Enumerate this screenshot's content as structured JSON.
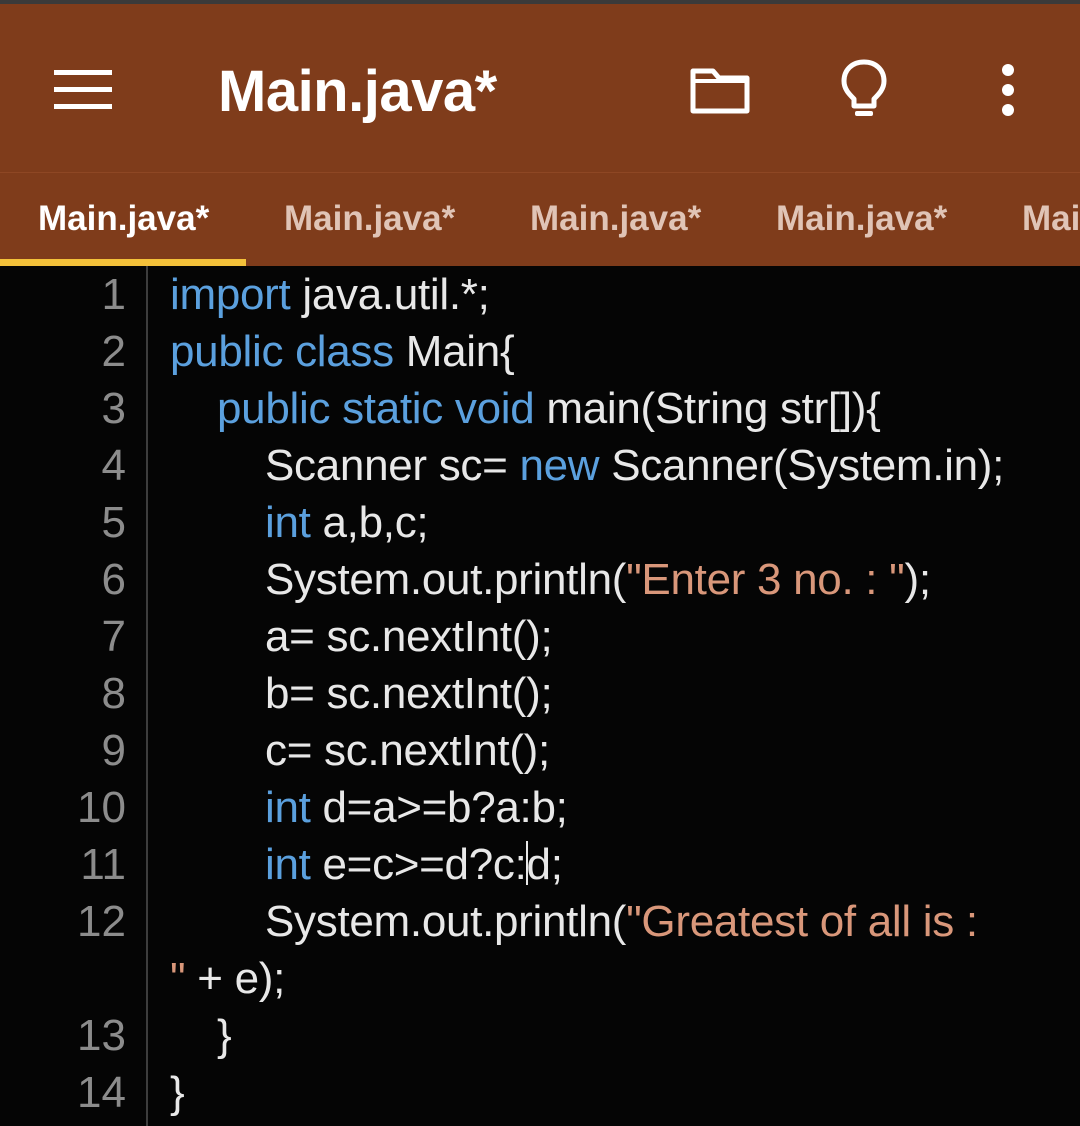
{
  "toolbar": {
    "menu_icon": "hamburger-menu-icon",
    "title": "Main.java*",
    "folder_icon": "folder-icon",
    "bulb_icon": "lightbulb-icon",
    "more_icon": "more-vert-icon",
    "background_color": "#7f3c1b"
  },
  "tabs": [
    {
      "label": "Main.java*",
      "active": true
    },
    {
      "label": "Main.java*",
      "active": false
    },
    {
      "label": "Main.java*",
      "active": false
    },
    {
      "label": "Main.java*",
      "active": false
    },
    {
      "label": "Mai",
      "active": false
    }
  ],
  "editor": {
    "active_tab_indicator_color": "#f4c13a",
    "keyword_color": "#5ba0de",
    "string_color": "#d9977a",
    "line_numbers": [
      "1",
      "2",
      "3",
      "4",
      "5",
      "6",
      "7",
      "8",
      "9",
      "10",
      "11",
      "12",
      "13",
      "14"
    ],
    "lines": [
      {
        "kw1": "import",
        "text1": " java.util.*;"
      },
      {
        "kw1": "public class",
        "text1": " Main{"
      },
      {
        "kw1": "public static void",
        "text1": " main(String str[]){"
      },
      {
        "text1": "Scanner sc= ",
        "kw1": "new",
        "text2": " Scanner(System.in);"
      },
      {
        "kw1": "int",
        "text1": " a,b,c;"
      },
      {
        "text1": "System.out.println(",
        "str1": "\"Enter 3 no. : \"",
        "text2": ");"
      },
      {
        "text1": "a= sc.nextInt();"
      },
      {
        "text1": "b= sc.nextInt();"
      },
      {
        "text1": "c= sc.nextInt();"
      },
      {
        "kw1": "int",
        "text1": " d=a>=b?a:b;"
      },
      {
        "kw1": "int",
        "text1": " e=c>=d?c:",
        "text2": "d;"
      },
      {
        "text1": "System.out.println(",
        "str1": "\"Greatest of all is :",
        "str2": "\"",
        "text2": " + e);"
      },
      {
        "text1": "}"
      },
      {
        "text1": "}"
      }
    ]
  }
}
